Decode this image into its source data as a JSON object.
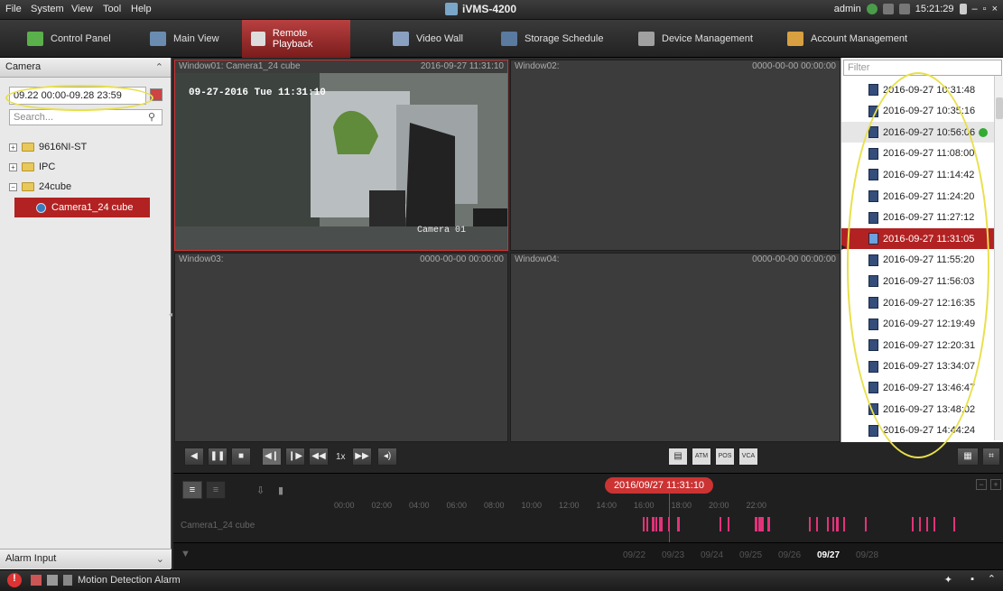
{
  "menu": {
    "file": "File",
    "system": "System",
    "view": "View",
    "tool": "Tool",
    "help": "Help"
  },
  "app_title": "iVMS-4200",
  "status_right": {
    "user": "admin",
    "time": "15:21:29"
  },
  "tabs": [
    {
      "label": "Control Panel"
    },
    {
      "label": "Main View"
    },
    {
      "label": "Remote Playback"
    },
    {
      "label": "Video Wall"
    },
    {
      "label": "Storage Schedule"
    },
    {
      "label": "Device Management"
    },
    {
      "label": "Account Management"
    }
  ],
  "left": {
    "header": "Camera",
    "date_range": "09.22 00:00-09.28 23:59",
    "search_placeholder": "Search...",
    "tree": [
      {
        "label": "9616NI-ST"
      },
      {
        "label": "IPC"
      },
      {
        "label": "24cube"
      },
      {
        "label": "Camera1_24 cube"
      }
    ],
    "alarm_input": "Alarm Input"
  },
  "windows": [
    {
      "title": "Window01: Camera1_24 cube",
      "time": "2016-09-27 11:31:10",
      "osd": "09-27-2016 Tue 11:31:10",
      "cam_label": "Camera 01"
    },
    {
      "title": "Window02:",
      "time": "0000-00-00 00:00:00"
    },
    {
      "title": "Window03:",
      "time": "0000-00-00 00:00:00"
    },
    {
      "title": "Window04:",
      "time": "0000-00-00 00:00:00"
    }
  ],
  "playback": {
    "speed": "1x"
  },
  "file_list": {
    "filter_placeholder": "Filter",
    "items": [
      "2016-09-27 10:31:48",
      "2016-09-27 10:35:16",
      "2016-09-27 10:56:06",
      "2016-09-27 11:08:00",
      "2016-09-27 11:14:42",
      "2016-09-27 11:24:20",
      "2016-09-27 11:27:12",
      "2016-09-27 11:31:05",
      "2016-09-27 11:55:20",
      "2016-09-27 11:56:03",
      "2016-09-27 12:16:35",
      "2016-09-27 12:19:49",
      "2016-09-27 12:20:31",
      "2016-09-27 13:34:07",
      "2016-09-27 13:46:47",
      "2016-09-27 13:48:02",
      "2016-09-27 14:44:24"
    ]
  },
  "timeline": {
    "cursor": "2016/09/27 11:31:10",
    "hours": [
      "00:00",
      "02:00",
      "04:00",
      "06:00",
      "08:00",
      "10:00",
      "12:00",
      "14:00",
      "16:00",
      "18:00",
      "20:00",
      "22:00"
    ],
    "camera_row": "Camera1_24 cube",
    "dates": [
      "09/22",
      "09/23",
      "09/24",
      "09/25",
      "09/26",
      "09/27",
      "09/28"
    ],
    "current_date": "09/27"
  },
  "status": {
    "alarm": "Motion Detection Alarm"
  },
  "colors": {
    "accent": "#b22222",
    "highlight": "#e8e04a",
    "recording": "#e2337a"
  }
}
